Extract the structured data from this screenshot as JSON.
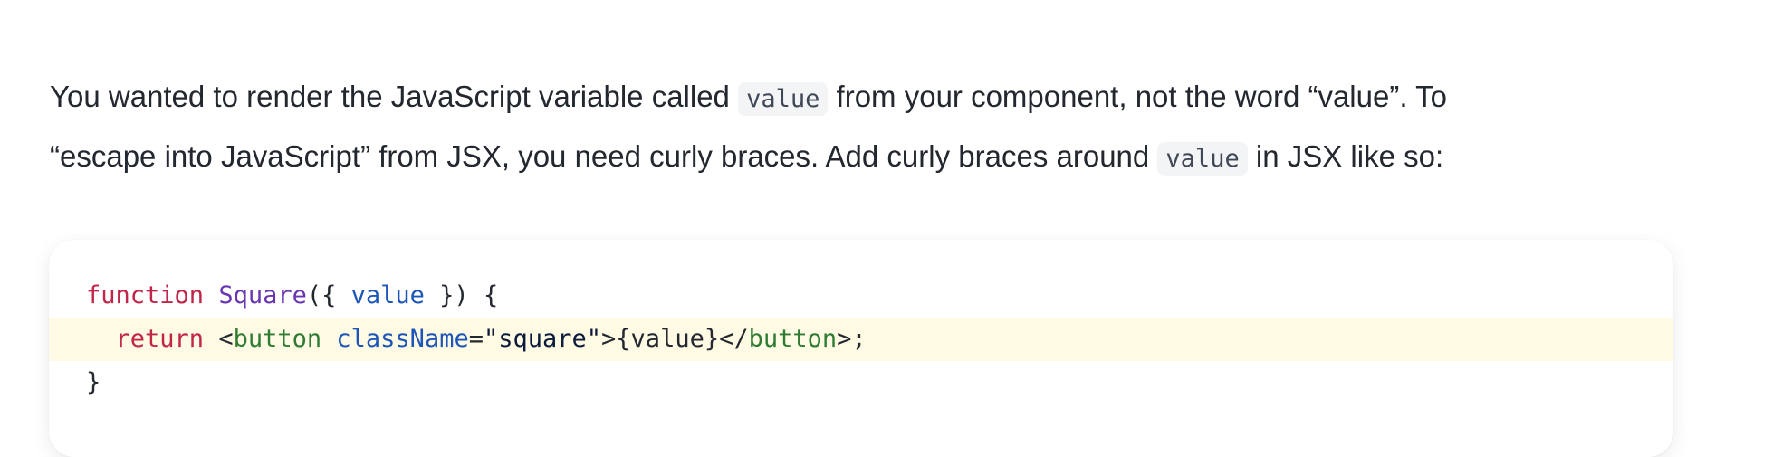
{
  "paragraph": {
    "line1_before": "You wanted to render the JavaScript variable called ",
    "code1": "value",
    "line1_after": " from your component, not the word “value”. To",
    "line2_before": "“escape into JavaScript” from JSX, you need curly braces. Add curly braces around ",
    "code2": "value",
    "line2_after": " in JSX like so:"
  },
  "code": {
    "line1": {
      "keyword": "function",
      "space1": " ",
      "name": "Square",
      "open": "({ ",
      "param": "value",
      "close": " }) {"
    },
    "line2": {
      "indent": "  ",
      "keyword": "return",
      "space1": " ",
      "lt": "<",
      "tag": "button",
      "space2": " ",
      "attr": "className",
      "eq": "=",
      "str": "\"square\"",
      "gt": ">",
      "expr": "{value}",
      "close_lt": "</",
      "close_tag": "button",
      "close_gt": ">;"
    },
    "line3": {
      "brace": "}"
    }
  },
  "colors": {
    "keyword": "#c1254a",
    "function_name": "#6a35b2",
    "attribute": "#1d56b8",
    "tag": "#2e7c34",
    "highlight_line": "#fefae3"
  }
}
